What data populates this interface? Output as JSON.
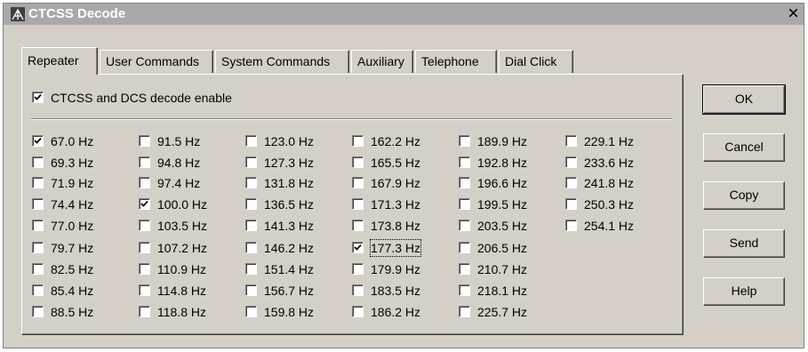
{
  "window": {
    "title": "CTCSS Decode",
    "icon": "radio-tower-icon",
    "close_icon": "close-icon"
  },
  "tabs": [
    "Repeater",
    "User Commands",
    "System Commands",
    "Auxiliary",
    "Telephone",
    "Dial Click"
  ],
  "active_tab": "Repeater",
  "enable": {
    "label": "CTCSS and DCS decode enable",
    "checked": true
  },
  "tones": [
    {
      "label": "67.0 Hz",
      "checked": true
    },
    {
      "label": "69.3 Hz",
      "checked": false
    },
    {
      "label": "71.9 Hz",
      "checked": false
    },
    {
      "label": "74.4 Hz",
      "checked": false
    },
    {
      "label": "77.0 Hz",
      "checked": false
    },
    {
      "label": "79.7 Hz",
      "checked": false
    },
    {
      "label": "82.5 Hz",
      "checked": false
    },
    {
      "label": "85.4 Hz",
      "checked": false
    },
    {
      "label": "88.5 Hz",
      "checked": false
    },
    {
      "label": "91.5 Hz",
      "checked": false
    },
    {
      "label": "94.8 Hz",
      "checked": false
    },
    {
      "label": "97.4 Hz",
      "checked": false
    },
    {
      "label": "100.0 Hz",
      "checked": true
    },
    {
      "label": "103.5 Hz",
      "checked": false
    },
    {
      "label": "107.2 Hz",
      "checked": false
    },
    {
      "label": "110.9 Hz",
      "checked": false
    },
    {
      "label": "114.8 Hz",
      "checked": false
    },
    {
      "label": "118.8 Hz",
      "checked": false
    },
    {
      "label": "123.0 Hz",
      "checked": false
    },
    {
      "label": "127.3 Hz",
      "checked": false
    },
    {
      "label": "131.8 Hz",
      "checked": false
    },
    {
      "label": "136.5 Hz",
      "checked": false
    },
    {
      "label": "141.3 Hz",
      "checked": false
    },
    {
      "label": "146.2 Hz",
      "checked": false
    },
    {
      "label": "151.4 Hz",
      "checked": false
    },
    {
      "label": "156.7 Hz",
      "checked": false
    },
    {
      "label": "159.8 Hz",
      "checked": false
    },
    {
      "label": "162.2 Hz",
      "checked": false
    },
    {
      "label": "165.5 Hz",
      "checked": false
    },
    {
      "label": "167.9 Hz",
      "checked": false
    },
    {
      "label": "171.3 Hz",
      "checked": false
    },
    {
      "label": "173.8 Hz",
      "checked": false
    },
    {
      "label": "177.3 Hz",
      "checked": true,
      "focused": true
    },
    {
      "label": "179.9 Hz",
      "checked": false
    },
    {
      "label": "183.5 Hz",
      "checked": false
    },
    {
      "label": "186.2 Hz",
      "checked": false
    },
    {
      "label": "189.9 Hz",
      "checked": false
    },
    {
      "label": "192.8 Hz",
      "checked": false
    },
    {
      "label": "196.6 Hz",
      "checked": false
    },
    {
      "label": "199.5 Hz",
      "checked": false
    },
    {
      "label": "203.5 Hz",
      "checked": false
    },
    {
      "label": "206.5 Hz",
      "checked": false
    },
    {
      "label": "210.7 Hz",
      "checked": false
    },
    {
      "label": "218.1 Hz",
      "checked": false
    },
    {
      "label": "225.7 Hz",
      "checked": false
    },
    {
      "label": "229.1 Hz",
      "checked": false
    },
    {
      "label": "233.6 Hz",
      "checked": false
    },
    {
      "label": "241.8 Hz",
      "checked": false
    },
    {
      "label": "250.3 Hz",
      "checked": false
    },
    {
      "label": "254.1 Hz",
      "checked": false
    }
  ],
  "buttons": {
    "ok": "OK",
    "cancel": "Cancel",
    "copy": "Copy",
    "send": "Send",
    "help": "Help"
  }
}
